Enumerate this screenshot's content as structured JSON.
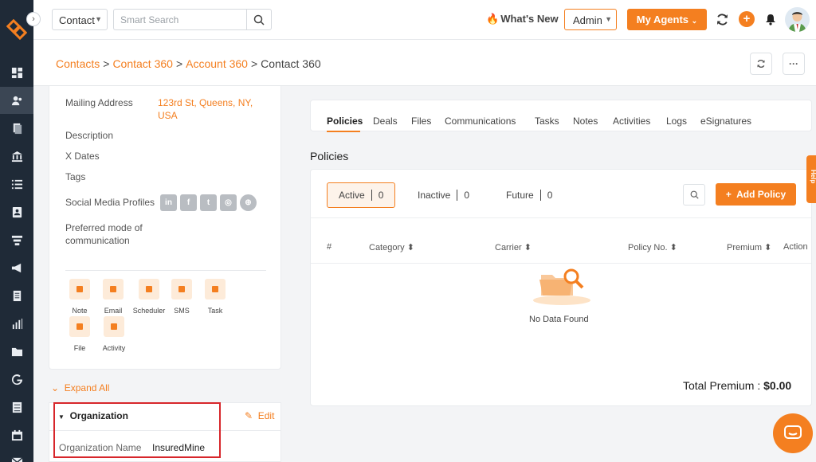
{
  "topbar": {
    "context_select": "Contact",
    "search_placeholder": "Smart Search",
    "whats_new": "What's New",
    "admin_select": "Admin",
    "my_agents": "My Agents"
  },
  "breadcrumb": {
    "items": [
      "Contacts",
      "Contact 360",
      "Account 360"
    ],
    "current": "Contact 360",
    "separator": ">"
  },
  "details": {
    "mailing_label": "Mailing Address",
    "mailing_line1": "123rd St, Queens, NY,",
    "mailing_line2": "USA",
    "description_label": "Description",
    "xdates_label": "X Dates",
    "tags_label": "Tags",
    "social_label": "Social Media Profiles",
    "comm_label_1": "Preferred mode of",
    "comm_label_2": "communication"
  },
  "actions": [
    "Note",
    "Email",
    "Scheduler",
    "SMS",
    "Task",
    "File",
    "Activity"
  ],
  "expand_all": "Expand All",
  "organization": {
    "title": "Organization",
    "edit": "Edit",
    "name_label": "Organization Name",
    "name_value": "InsuredMine"
  },
  "tabs": [
    "Policies",
    "Deals",
    "Files",
    "Communications",
    "Tasks",
    "Notes",
    "Activities",
    "Logs",
    "eSignatures"
  ],
  "policies": {
    "section_title": "Policies",
    "filters": [
      {
        "label": "Active",
        "count": "0"
      },
      {
        "label": "Inactive",
        "count": "0"
      },
      {
        "label": "Future",
        "count": "0"
      }
    ],
    "add_button": "Add Policy",
    "columns": [
      "#",
      "Category",
      "Carrier",
      "Policy No.",
      "Premium",
      "Action"
    ],
    "empty_text": "No Data Found",
    "total_label": "Total Premium :",
    "total_value": "$0.00"
  },
  "help_tab": "Help",
  "colors": {
    "accent": "#f47f20",
    "rail": "#1f2a37",
    "highlight": "#d7262b"
  }
}
